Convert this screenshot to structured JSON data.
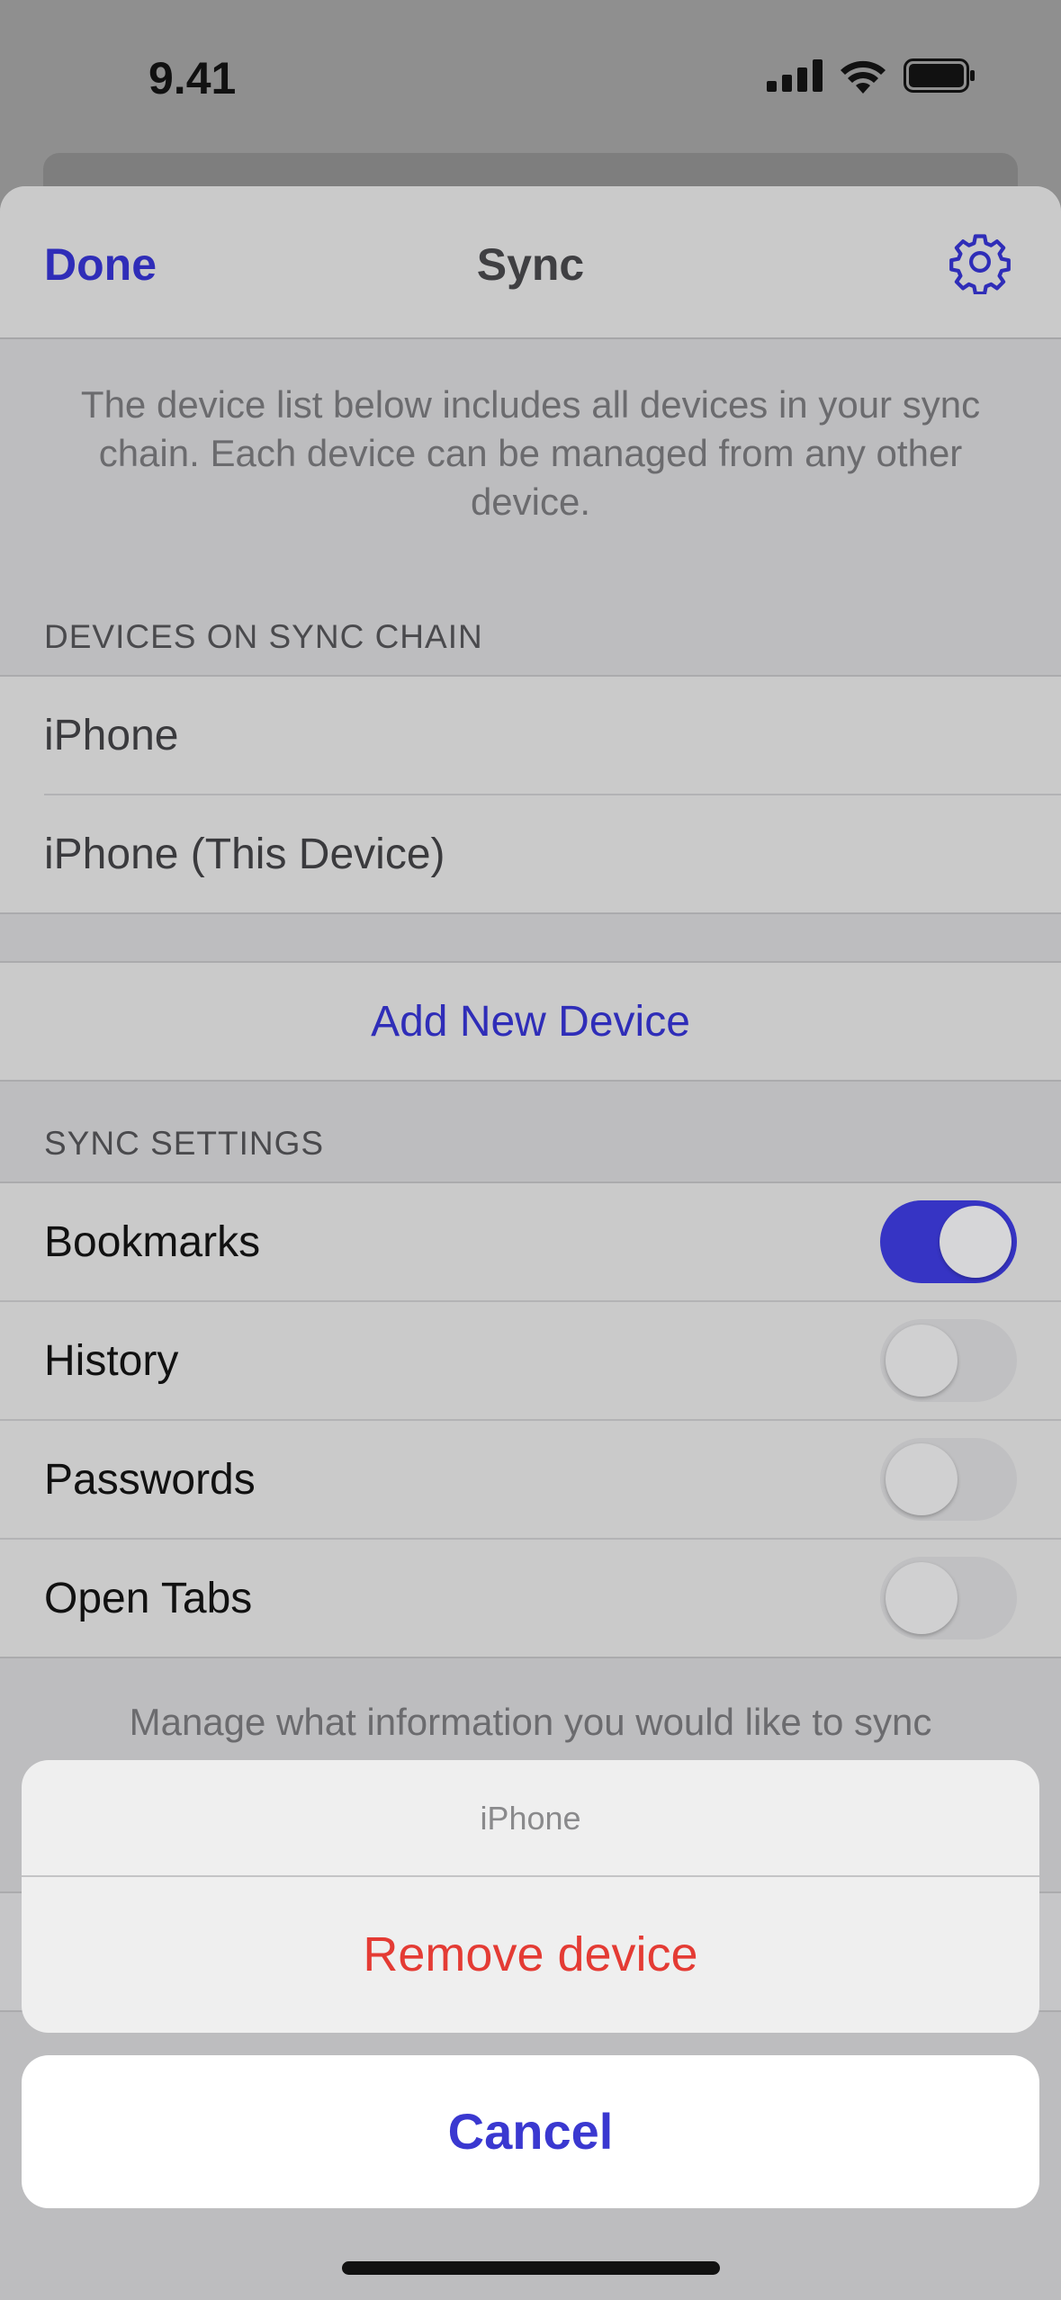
{
  "status_bar": {
    "time": "9.41",
    "icons": [
      "cellular-signal-icon",
      "wifi-icon",
      "battery-icon"
    ]
  },
  "nav": {
    "done_label": "Done",
    "title": "Sync",
    "settings_icon": "gear-icon"
  },
  "description": "The device list below includes all devices in your sync chain. Each device can be managed from any other device.",
  "devices_section": {
    "header": "DEVICES ON SYNC CHAIN",
    "devices": [
      "iPhone",
      "iPhone (This Device)"
    ]
  },
  "add_device_label": "Add New Device",
  "sync_settings": {
    "header": "SYNC SETTINGS",
    "items": [
      {
        "label": "Bookmarks",
        "enabled": true
      },
      {
        "label": "History",
        "enabled": false
      },
      {
        "label": "Passwords",
        "enabled": false
      },
      {
        "label": "Open Tabs",
        "enabled": false
      }
    ],
    "footer": "Manage what information you would like to sync"
  },
  "action_sheet": {
    "title": "iPhone",
    "remove_label": "Remove device",
    "cancel_label": "Cancel"
  },
  "colors": {
    "accent": "#2f2db8",
    "destructive": "#e43b34",
    "toggle_on": "#3634c4"
  }
}
